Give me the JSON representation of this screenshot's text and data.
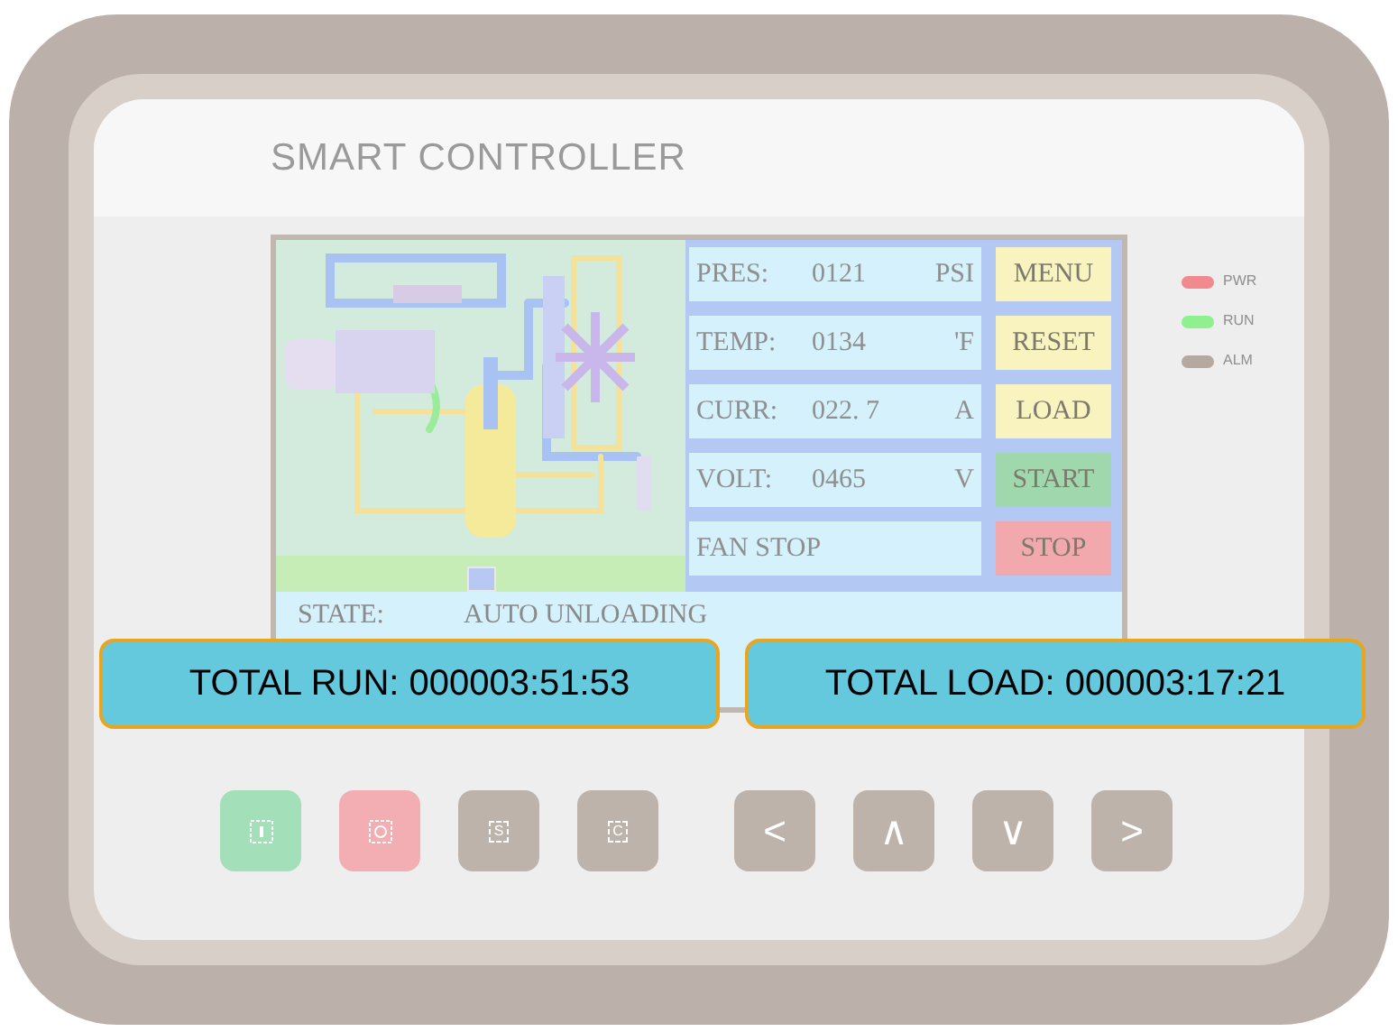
{
  "brand": "SMART CONTROLLER",
  "readings": [
    {
      "kind": "reading",
      "label": "PRES:",
      "value": "0121",
      "unit": "PSI"
    },
    {
      "kind": "reading",
      "label": "TEMP:",
      "value": "0134",
      "unit": "'F"
    },
    {
      "kind": "reading",
      "label": "CURR:",
      "value": "022. 7",
      "unit": "A"
    },
    {
      "kind": "reading",
      "label": "VOLT:",
      "value": "0465",
      "unit": "V"
    },
    {
      "kind": "status",
      "label": "FAN STOP"
    }
  ],
  "screen_buttons": [
    {
      "label": "MENU",
      "color": "#f8f3bf"
    },
    {
      "label": "RESET",
      "color": "#f8f3bf"
    },
    {
      "label": "LOAD",
      "color": "#f8f3bf"
    },
    {
      "label": "START",
      "color": "#9fd8ad"
    },
    {
      "label": "STOP",
      "color": "#f2a9ad"
    }
  ],
  "state": {
    "label": "STATE:",
    "value": "AUTO UNLOADING"
  },
  "leds": [
    {
      "label": "PWR",
      "color": "#f08a8f"
    },
    {
      "label": "RUN",
      "color": "#8ef08e"
    },
    {
      "label": "ALM",
      "color": "#b5a89f"
    }
  ],
  "keys": [
    {
      "kind": "run",
      "color": "#a3dfb9"
    },
    {
      "kind": "stop",
      "color": "#f2aeb3"
    },
    {
      "kind": "letter",
      "text": "S",
      "color": "#bdb3ab"
    },
    {
      "kind": "letter",
      "text": "C",
      "color": "#bdb3ab"
    },
    {
      "kind": "arrow",
      "text": "<",
      "color": "#bdb3ab"
    },
    {
      "kind": "arrow",
      "text": "∧",
      "color": "#bdb3ab"
    },
    {
      "kind": "arrow",
      "text": "∨",
      "color": "#bdb3ab"
    },
    {
      "kind": "arrow",
      "text": ">",
      "color": "#bdb3ab"
    }
  ],
  "callouts": [
    {
      "text": "TOTAL RUN: 000003:51:53"
    },
    {
      "text": "TOTAL LOAD: 000003:17:21"
    }
  ]
}
